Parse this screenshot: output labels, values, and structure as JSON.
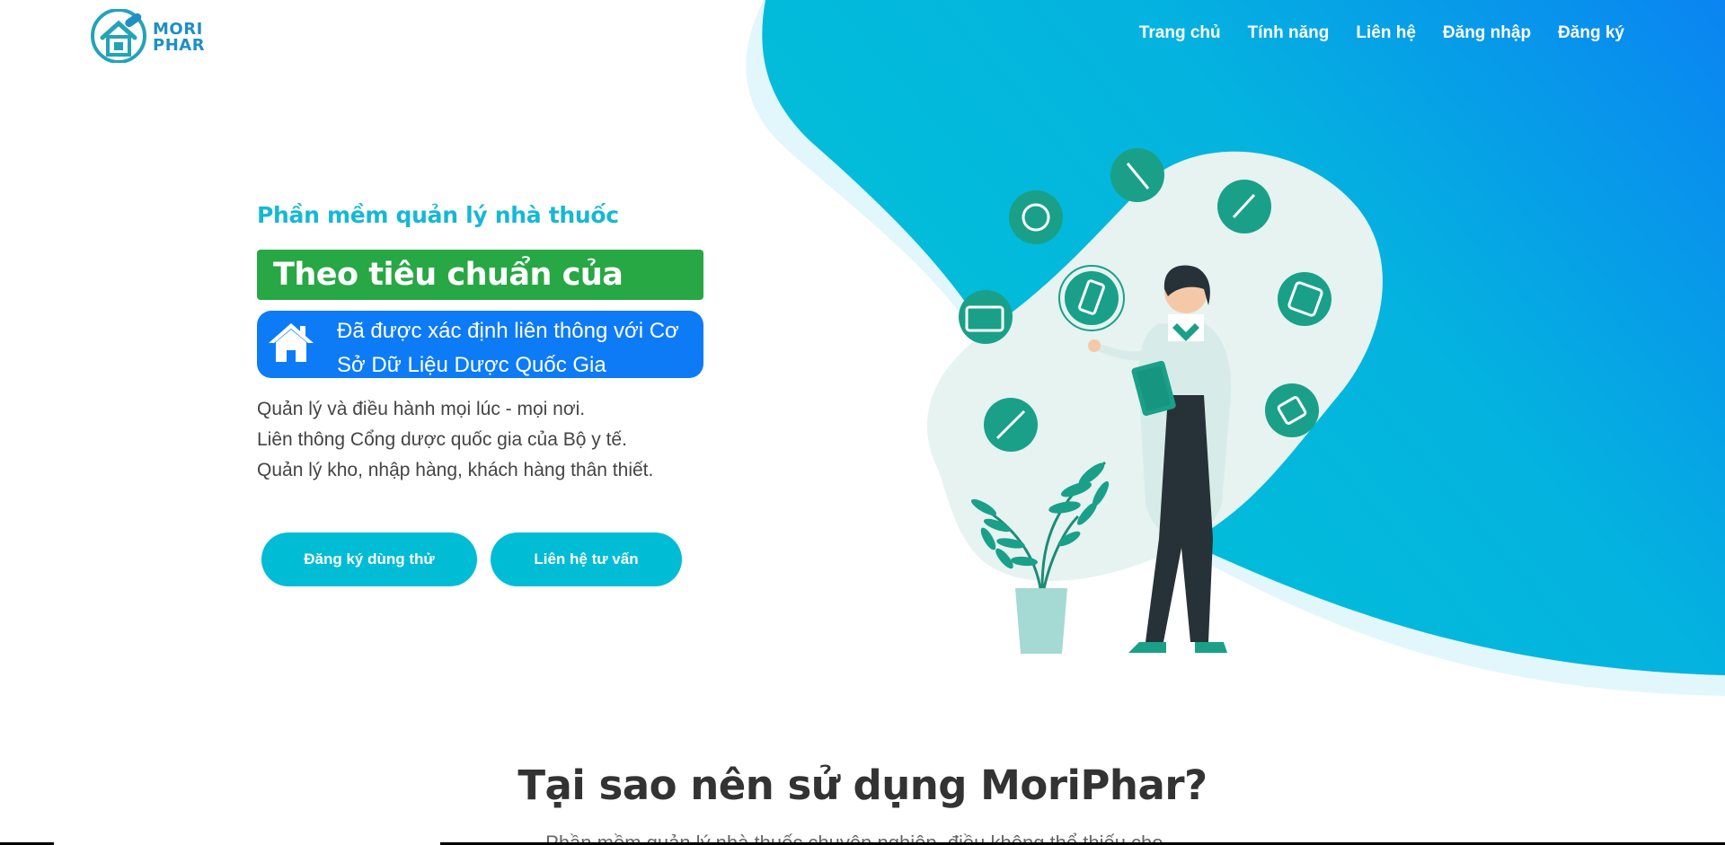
{
  "brand": {
    "logo_line1": "MORI",
    "logo_line2": "PHAR"
  },
  "nav": {
    "items": [
      {
        "label": "Trang chủ"
      },
      {
        "label": "Tính năng"
      },
      {
        "label": "Liên hệ"
      },
      {
        "label": "Đăng nhập"
      },
      {
        "label": "Đăng ký"
      }
    ]
  },
  "hero": {
    "subtitle": "Phần mềm quản lý nhà thuốc",
    "badge": "Theo tiêu chuẩn của GPP",
    "link_text": "Đã được xác định liên thông với Cơ Sở Dữ Liệu Dược Quốc Gia",
    "desc": [
      "Quản lý và điều hành mọi lúc - mọi nơi.",
      "Liên thông Cổng dược quốc gia của Bộ y tế.",
      "Quản lý kho, nhập hàng, khách hàng thân thiết."
    ],
    "btn_trial": "Đăng ký dùng thử",
    "btn_contact": "Liên hệ tư vấn"
  },
  "section": {
    "title": "Tại sao nên sử dụng MoriPhar?",
    "subtitle": "Phần mềm quản lý nhà thuốc chuyên nghiệp, điều không thể thiếu cho..."
  },
  "colors": {
    "accent": "#00bcd4",
    "green": "#28a745",
    "blue": "#0d7bf6",
    "teal_icon": "#1aa088",
    "subtitle": "#16b8d3"
  }
}
